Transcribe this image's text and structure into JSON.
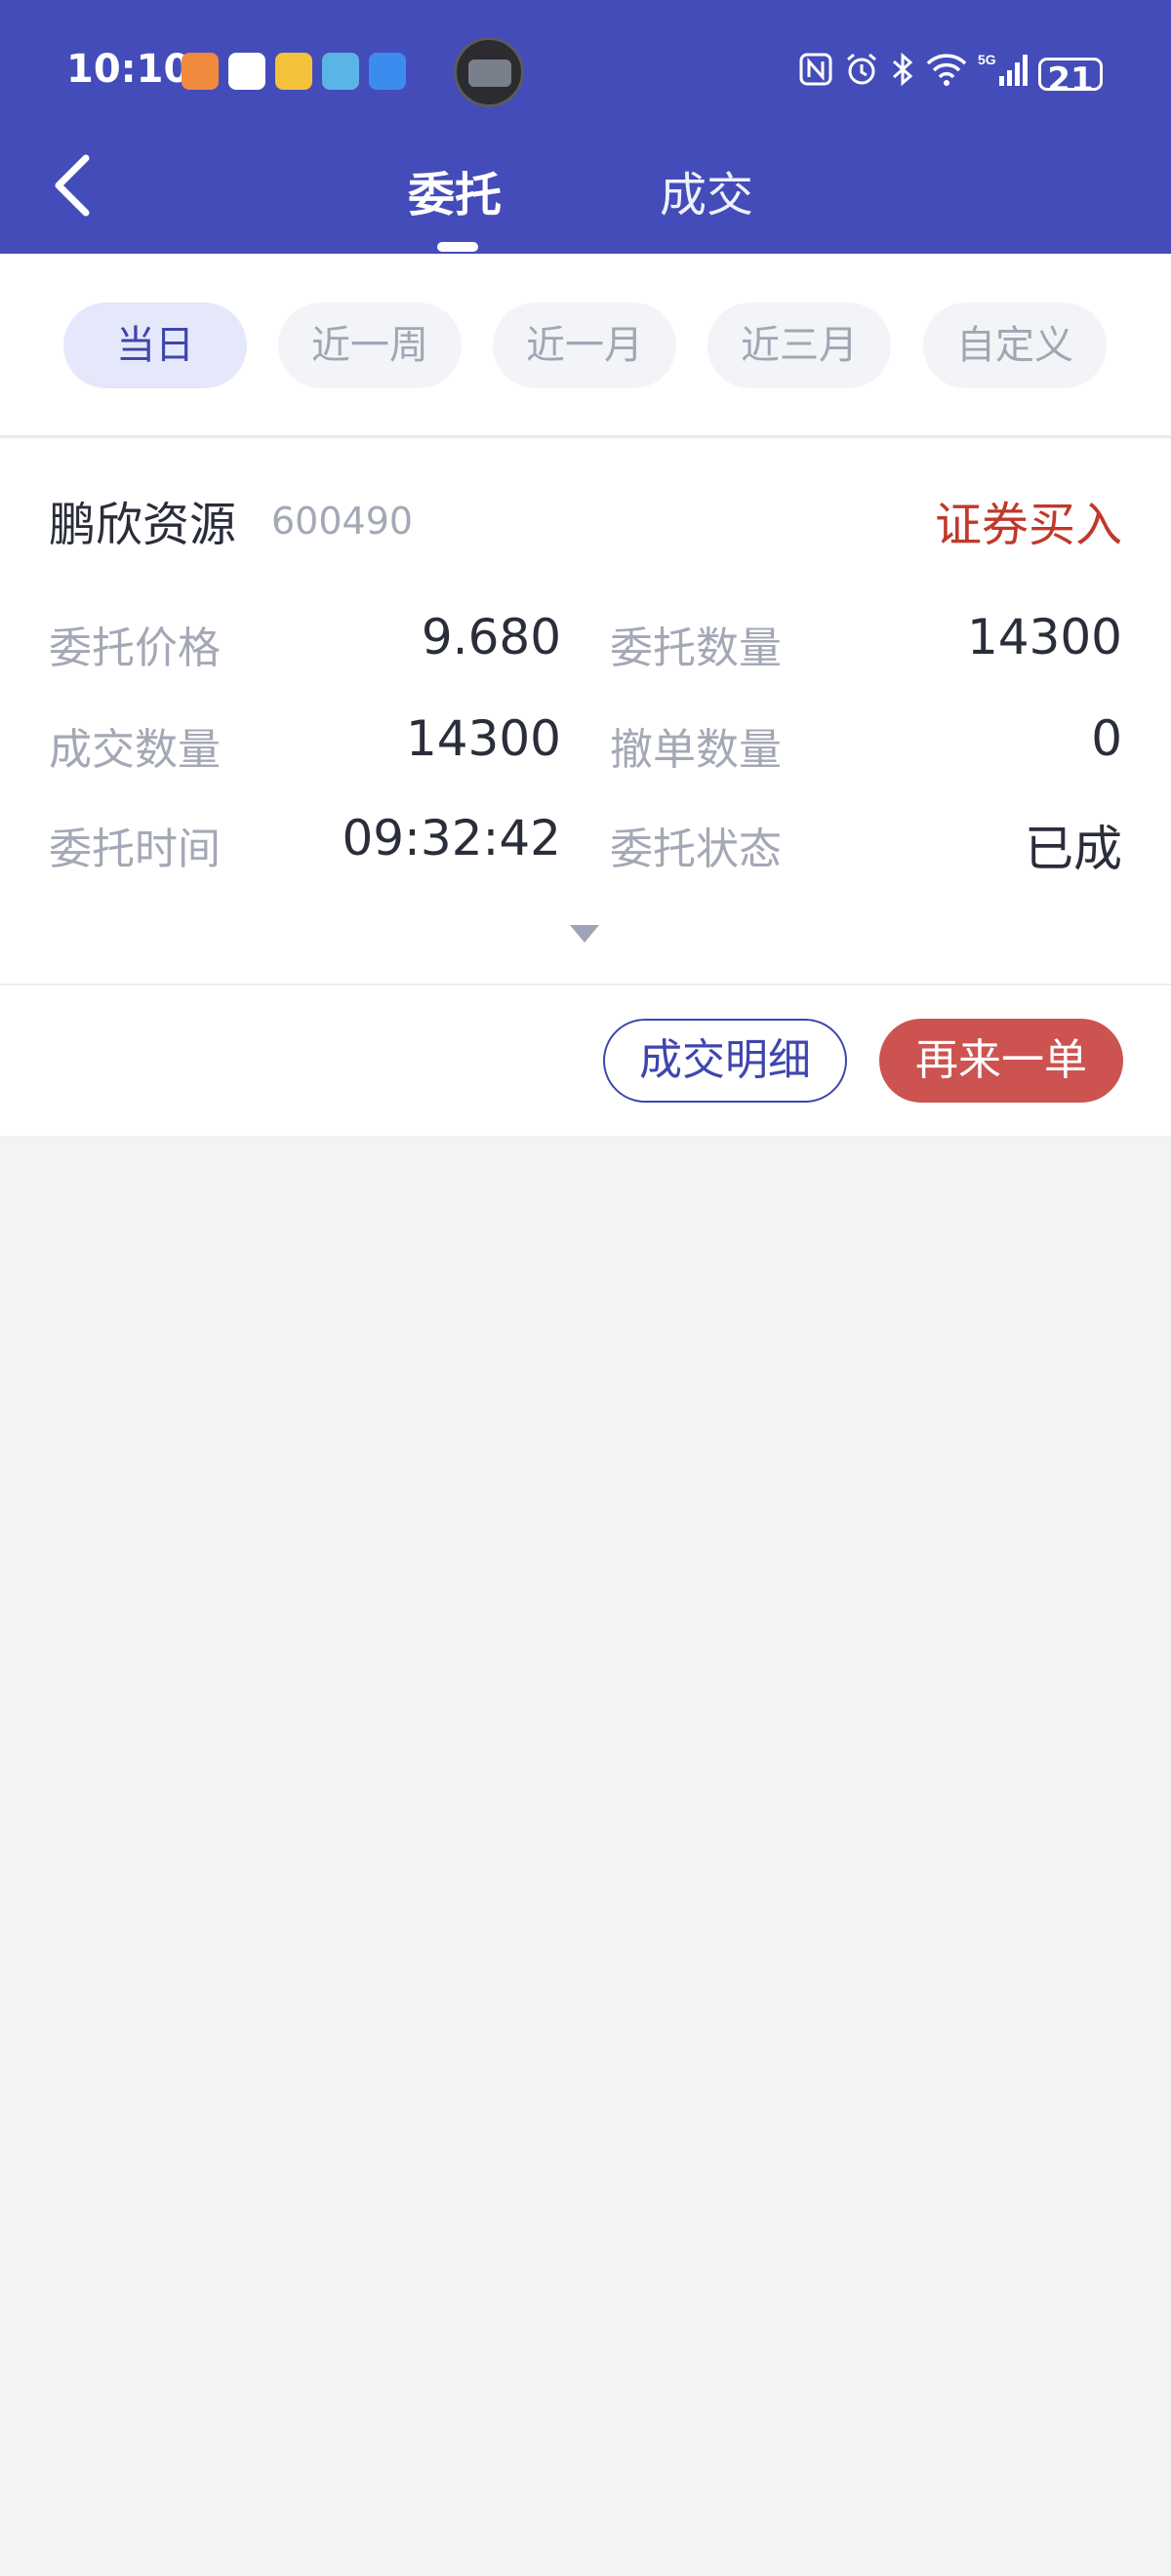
{
  "status_bar": {
    "time": "10:10",
    "battery": "21"
  },
  "header": {
    "tabs": [
      {
        "label": "委托"
      },
      {
        "label": "成交"
      }
    ]
  },
  "filters": {
    "chips": [
      {
        "label": "当日"
      },
      {
        "label": "近一周"
      },
      {
        "label": "近一月"
      },
      {
        "label": "近三月"
      },
      {
        "label": "自定义"
      }
    ]
  },
  "order": {
    "stock_name": "鹏欣资源",
    "stock_code": "600490",
    "order_type": "证券买入",
    "fields": [
      {
        "label": "委托价格",
        "value": "9.680"
      },
      {
        "label": "委托数量",
        "value": "14300"
      },
      {
        "label": "成交数量",
        "value": "14300"
      },
      {
        "label": "撤单数量",
        "value": "0"
      },
      {
        "label": "委托时间",
        "value": "09:32:42"
      },
      {
        "label": "委托状态",
        "value": "已成"
      }
    ],
    "actions": {
      "detail": "成交明细",
      "again": "再来一单"
    }
  },
  "colors": {
    "header_bg": "#444cb9",
    "accent": "#3f46ad",
    "buy_red": "#c0392b",
    "action_red": "#cc5350",
    "page_bg": "#f2f3f5"
  }
}
